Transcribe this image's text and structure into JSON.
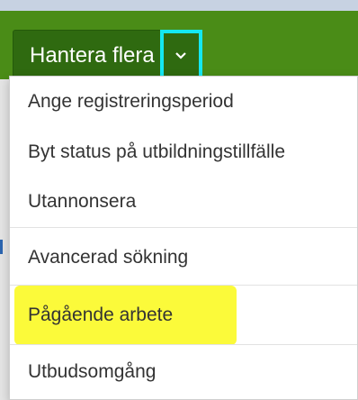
{
  "header": {
    "manage_multiple_label": "Hantera flera",
    "chevron_icon": "chevron-down-icon",
    "accent_color": "#4a8c17",
    "focus_outline_color": "#14e8f2"
  },
  "menu": {
    "items": [
      {
        "label": "Ange registreringsperiod"
      },
      {
        "label": "Byt status på utbildningstillfälle"
      },
      {
        "label": "Utannonsera"
      },
      {
        "label": "Avancerad sökning"
      },
      {
        "label": "Pågående arbete",
        "highlight_color": "#fbfa3a"
      },
      {
        "label": "Utbudsomgång"
      }
    ]
  }
}
